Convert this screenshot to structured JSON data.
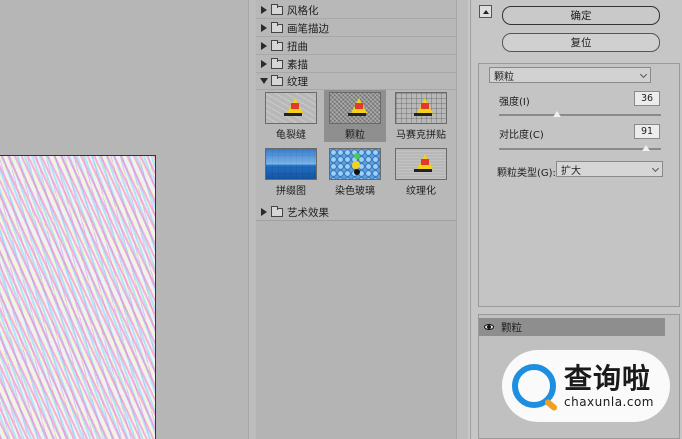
{
  "categories": [
    {
      "label": "风格化",
      "expanded": false
    },
    {
      "label": "画笔描边",
      "expanded": false
    },
    {
      "label": "扭曲",
      "expanded": false
    },
    {
      "label": "素描",
      "expanded": false
    },
    {
      "label": "纹理",
      "expanded": true
    },
    {
      "label": "艺术效果",
      "expanded": false
    }
  ],
  "texture_filters": [
    {
      "label": "龟裂缝",
      "selected": false,
      "icon": "cracked-boat-thumbnail"
    },
    {
      "label": "颗粒",
      "selected": true,
      "icon": "grain-boat-thumbnail"
    },
    {
      "label": "马赛克拼贴",
      "selected": false,
      "icon": "mosaic-boat-thumbnail"
    },
    {
      "label": "拼缀图",
      "selected": false,
      "icon": "patchwork-thumbnail"
    },
    {
      "label": "染色玻璃",
      "selected": false,
      "icon": "stained-glass-thumbnail"
    },
    {
      "label": "纹理化",
      "selected": false,
      "icon": "texturizer-boat-thumbnail"
    }
  ],
  "buttons": {
    "ok": "确定",
    "reset": "复位"
  },
  "filter_select": {
    "value": "颗粒"
  },
  "params": {
    "intensity": {
      "label": "强度(I)",
      "value": "36",
      "fraction": 0.36
    },
    "contrast": {
      "label": "对比度(C)",
      "value": "91",
      "fraction": 0.91
    },
    "grain_type": {
      "label": "颗粒类型(G):",
      "value": "扩大"
    }
  },
  "layers": [
    {
      "label": "颗粒",
      "visible": true
    }
  ],
  "watermark": {
    "cn": "查询啦",
    "en": "chaxunla.com"
  },
  "colors": {
    "accent_blue": "#1e8fe0",
    "accent_orange": "#f0a020",
    "selected_row": "#8e8e8e"
  }
}
